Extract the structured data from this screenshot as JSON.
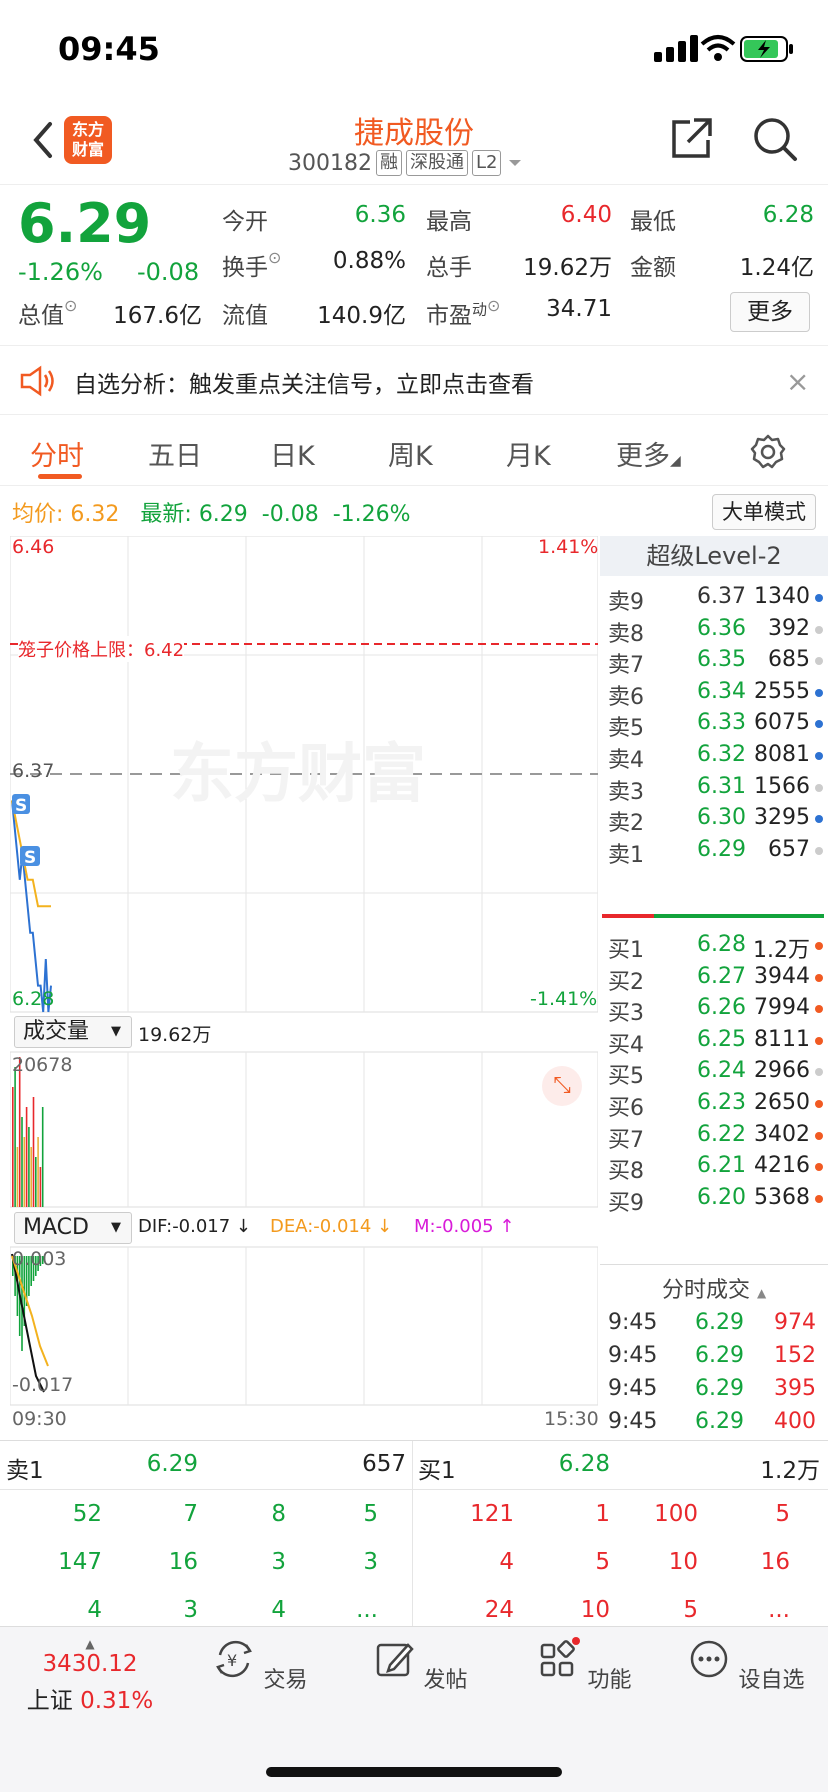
{
  "status": {
    "time": "09:45"
  },
  "header": {
    "logo": [
      "东方",
      "财富"
    ],
    "title": "捷成股份",
    "code": "300182",
    "tags": [
      "融",
      "深股通",
      "L2"
    ]
  },
  "quote": {
    "price": "6.29",
    "pct": "-1.26%",
    "change": "-0.08",
    "fields": [
      {
        "label": "今开",
        "value": "6.36",
        "color": "green"
      },
      {
        "label": "最高",
        "value": "6.40",
        "color": "red"
      },
      {
        "label": "最低",
        "value": "6.28",
        "color": "green"
      },
      {
        "label": "换手",
        "value": "0.88%",
        "color": "black"
      },
      {
        "label": "总手",
        "value": "19.62万",
        "color": "black"
      },
      {
        "label": "金额",
        "value": "1.24亿",
        "color": "black"
      },
      {
        "label": "总值",
        "value": "167.6亿",
        "color": "black"
      },
      {
        "label": "流值",
        "value": "140.9亿",
        "color": "black"
      },
      {
        "label": "市盈",
        "sup": "动",
        "value": "34.71",
        "color": "black"
      }
    ],
    "more": "更多"
  },
  "notice": {
    "text": "自选分析：触发重点关注信号，立即点击查看",
    "close": "×"
  },
  "tabs": [
    "分时",
    "五日",
    "日K",
    "周K",
    "月K",
    "更多"
  ],
  "infoline": {
    "avg_label": "均价:",
    "avg": "6.32",
    "latest_label": "最新:",
    "latest": "6.29",
    "change": "-0.08",
    "pct": "-1.26%",
    "big_order": "大单模式"
  },
  "chart": {
    "ymax": "6.46",
    "ymax_pct": "1.41%",
    "ymin": "6.28",
    "ymin_pct": "-1.41%",
    "cage": "笼子价格上限：6.42",
    "prev_close": "6.37",
    "watermark": "东方财富",
    "vol_label": "成交量",
    "vol_value": "19.62万",
    "vol_max": "20678",
    "macd_label": "MACD",
    "dif": "DIF:-0.017 ↓",
    "dea": "DEA:-0.014 ↓",
    "m": "M:-0.005 ↑",
    "macd_max": "0.003",
    "macd_min": "-0.017",
    "t_start": "09:30",
    "t_end": "15:30"
  },
  "chart_data": {
    "type": "line",
    "title": "",
    "series": [
      {
        "x": [
          "09:30",
          "09:31",
          "09:32",
          "09:33",
          "09:34",
          "09:35",
          "09:36",
          "09:37",
          "09:38",
          "09:39",
          "09:40",
          "09:41",
          "09:42",
          "09:43",
          "09:44",
          "09:45"
        ],
        "values": [
          6.36,
          6.35,
          6.34,
          6.33,
          6.34,
          6.33,
          6.32,
          6.31,
          6.31,
          6.3,
          6.29,
          6.29,
          6.28,
          6.3,
          6.28,
          6.29
        ]
      },
      {
        "x": [
          "09:30",
          "09:32",
          "09:34",
          "09:36",
          "09:38",
          "09:40",
          "09:42",
          "09:45"
        ],
        "values": [
          6.36,
          6.35,
          6.34,
          6.33,
          6.33,
          6.32,
          6.32,
          6.32
        ]
      }
    ],
    "ylim": [
      6.28,
      6.46
    ],
    "xlabel": "",
    "ylabel": ""
  },
  "level2": {
    "title": "超级Level-2",
    "sell": [
      {
        "label": "卖9",
        "price": "6.37",
        "vol": "1340",
        "dot": "blue"
      },
      {
        "label": "卖8",
        "price": "6.36",
        "vol": "392",
        "dot": "gray"
      },
      {
        "label": "卖7",
        "price": "6.35",
        "vol": "685",
        "dot": "gray"
      },
      {
        "label": "卖6",
        "price": "6.34",
        "vol": "2555",
        "dot": "blue"
      },
      {
        "label": "卖5",
        "price": "6.33",
        "vol": "6075",
        "dot": "blue"
      },
      {
        "label": "卖4",
        "price": "6.32",
        "vol": "8081",
        "dot": "blue"
      },
      {
        "label": "卖3",
        "price": "6.31",
        "vol": "1566",
        "dot": "gray"
      },
      {
        "label": "卖2",
        "price": "6.30",
        "vol": "3295",
        "dot": "blue"
      },
      {
        "label": "卖1",
        "price": "6.29",
        "vol": "657",
        "dot": "gray"
      }
    ],
    "buy": [
      {
        "label": "买1",
        "price": "6.28",
        "vol": "1.2万",
        "dot": "orange"
      },
      {
        "label": "买2",
        "price": "6.27",
        "vol": "3944",
        "dot": "orange"
      },
      {
        "label": "买3",
        "price": "6.26",
        "vol": "7994",
        "dot": "orange"
      },
      {
        "label": "买4",
        "price": "6.25",
        "vol": "8111",
        "dot": "orange"
      },
      {
        "label": "买5",
        "price": "6.24",
        "vol": "2966",
        "dot": "gray"
      },
      {
        "label": "买6",
        "price": "6.23",
        "vol": "2650",
        "dot": "orange"
      },
      {
        "label": "买7",
        "price": "6.22",
        "vol": "3402",
        "dot": "orange"
      },
      {
        "label": "买8",
        "price": "6.21",
        "vol": "4216",
        "dot": "orange"
      },
      {
        "label": "买9",
        "price": "6.20",
        "vol": "5368",
        "dot": "orange"
      }
    ],
    "trades_title": "分时成交",
    "trades": [
      {
        "t": "9:45",
        "p": "6.29",
        "v": "974"
      },
      {
        "t": "9:45",
        "p": "6.29",
        "v": "152"
      },
      {
        "t": "9:45",
        "p": "6.29",
        "v": "395"
      },
      {
        "t": "9:45",
        "p": "6.29",
        "v": "400"
      }
    ]
  },
  "summary": {
    "sell1_label": "卖1",
    "sell1_price": "6.29",
    "sell1_vol": "657",
    "buy1_label": "买1",
    "buy1_price": "6.28",
    "buy1_vol": "1.2万",
    "sell_queue": [
      [
        "52",
        "7",
        "8",
        "5"
      ],
      [
        "147",
        "16",
        "3",
        "3"
      ],
      [
        "4",
        "3",
        "4",
        "..."
      ]
    ],
    "buy_queue": [
      [
        "121",
        "1",
        "100",
        "5"
      ],
      [
        "4",
        "5",
        "10",
        "16"
      ],
      [
        "24",
        "10",
        "5",
        "..."
      ]
    ]
  },
  "nav": {
    "index_value": "3430.12",
    "index_name": "上证",
    "index_pct": "0.31%",
    "items": [
      "交易",
      "发帖",
      "功能",
      "设自选"
    ]
  }
}
